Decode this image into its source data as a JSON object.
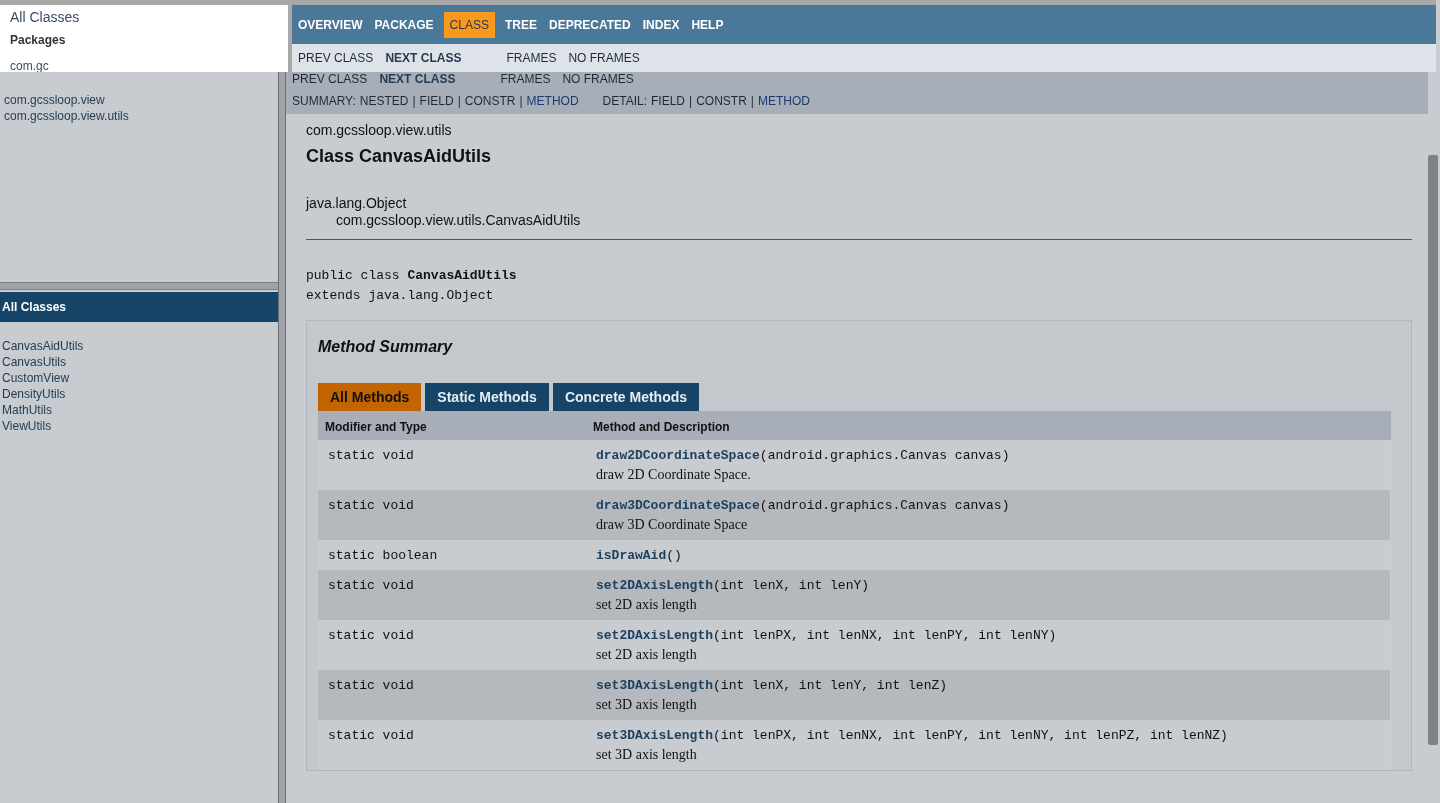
{
  "overlay": {
    "frame_title": "All Classes",
    "heading": "Packages",
    "cut_item": "com.gc",
    "nav": [
      {
        "label": "OVERVIEW",
        "selected": false
      },
      {
        "label": "PACKAGE",
        "selected": false
      },
      {
        "label": "CLASS",
        "selected": true
      },
      {
        "label": "TREE",
        "selected": false
      },
      {
        "label": "DEPRECATED",
        "selected": false
      },
      {
        "label": "INDEX",
        "selected": false
      },
      {
        "label": "HELP",
        "selected": false
      }
    ],
    "subnav": [
      {
        "label": "PREV CLASS",
        "bold": false
      },
      {
        "label": "NEXT CLASS",
        "bold": true
      },
      {
        "label": "FRAMES",
        "bold": false
      },
      {
        "label": "NO FRAMES",
        "bold": false
      }
    ]
  },
  "packages": [
    "com.gcssloop.view",
    "com.gcssloop.view.utils"
  ],
  "all_classes": {
    "title": "All Classes",
    "items": [
      "CanvasAidUtils",
      "CanvasUtils",
      "CustomView",
      "DensityUtils",
      "MathUtils",
      "ViewUtils"
    ]
  },
  "subnav": [
    {
      "label": "PREV CLASS",
      "bold": false
    },
    {
      "label": "NEXT CLASS",
      "bold": true
    },
    {
      "label": "FRAMES",
      "bold": false
    },
    {
      "label": "NO FRAMES",
      "bold": false
    }
  ],
  "summary": {
    "label": "SUMMARY:",
    "separator": "|",
    "items": [
      {
        "text": "NESTED",
        "link": false
      },
      {
        "text": "FIELD",
        "link": false
      },
      {
        "text": "CONSTR",
        "link": false
      },
      {
        "text": "METHOD",
        "link": true
      }
    ]
  },
  "detail": {
    "label": "DETAIL:",
    "separator": "|",
    "items": [
      {
        "text": "FIELD",
        "link": false
      },
      {
        "text": "CONSTR",
        "link": false
      },
      {
        "text": "METHOD",
        "link": true
      }
    ]
  },
  "package_name": "com.gcssloop.view.utils",
  "class_title": "Class CanvasAidUtils",
  "hierarchy": [
    "java.lang.Object",
    "com.gcssloop.view.utils.CanvasAidUtils"
  ],
  "declaration": [
    "public class **CanvasAidUtils**",
    "extends java.lang.Object"
  ],
  "method_summary": {
    "title": "Method Summary",
    "tabs": [
      {
        "label": "All Methods",
        "selected": true
      },
      {
        "label": "Static Methods",
        "selected": false
      },
      {
        "label": "Concrete Methods",
        "selected": false
      }
    ],
    "columns": [
      "Modifier and Type",
      "Method and Description"
    ],
    "rows": [
      {
        "type": "static void",
        "signature": "**draw2DCoordinateSpace**(android.graphics.Canvas canvas)",
        "description": "draw 2D Coordinate Space."
      },
      {
        "type": "static void",
        "signature": "**draw3DCoordinateSpace**(android.graphics.Canvas canvas)",
        "description": "draw 3D Coordinate Space"
      },
      {
        "type": "static boolean",
        "signature": "**isDrawAid**()"
      },
      {
        "type": "static void",
        "signature": "**set2DAxisLength**(int lenX, int lenY)",
        "description": "set 2D axis length"
      },
      {
        "type": "static void",
        "signature": "**set2DAxisLength**(int lenPX, int lenNX, int lenPY, int lenNY)",
        "description": "set 2D axis length"
      },
      {
        "type": "static void",
        "signature": "**set3DAxisLength**(int lenX, int lenY, int lenZ)",
        "description": "set 3D axis length"
      },
      {
        "type": "static void",
        "signature": "**set3DAxisLength**(int lenPX, int lenNX, int lenPY, int lenNY, int lenPZ, int lenNZ)",
        "description": "set 3D axis length"
      }
    ]
  }
}
